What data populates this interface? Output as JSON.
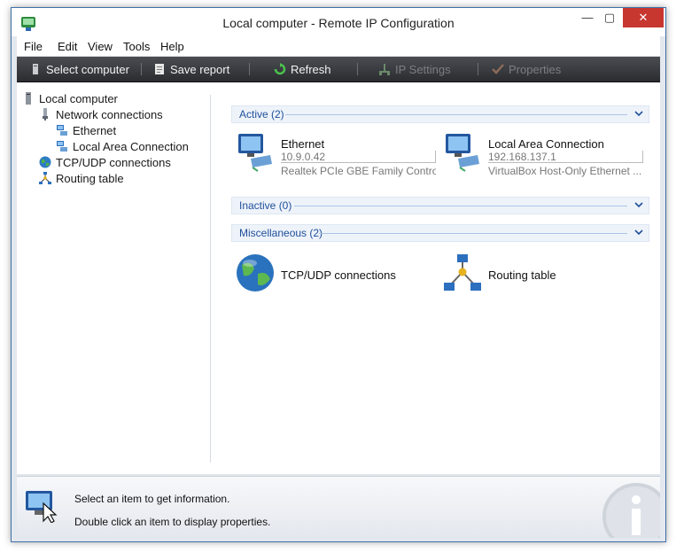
{
  "window": {
    "title": "Local computer - Remote IP Configuration"
  },
  "window_buttons": {
    "minimize": "—",
    "maximize": "▢",
    "close": "✕"
  },
  "menu": [
    "File",
    "Edit",
    "View",
    "Tools",
    "Help"
  ],
  "toolbar": {
    "select_computer": "Select computer",
    "save_report": "Save report",
    "refresh": "Refresh",
    "ip_settings": "IP Settings",
    "properties": "Properties"
  },
  "tree": {
    "root": "Local computer",
    "network_connections": "Network connections",
    "ethernet": "Ethernet",
    "local_area_connection": "Local Area Connection",
    "tcp_udp": "TCP/UDP connections",
    "routing_table": "Routing table"
  },
  "groups": {
    "active": "Active (2)",
    "inactive": "Inactive (0)",
    "miscellaneous": "Miscellaneous (2)"
  },
  "active_items": [
    {
      "name": "Ethernet",
      "ip": "10.9.0.42",
      "description": "Realtek PCIe GBE Family Contro..."
    },
    {
      "name": "Local Area Connection",
      "ip": "192.168.137.1",
      "description": "VirtualBox Host-Only Ethernet ..."
    }
  ],
  "misc_items": [
    {
      "name": "TCP/UDP connections"
    },
    {
      "name": "Routing table"
    }
  ],
  "status": {
    "line1": "Select an item to get information.",
    "line2": "Double click an item to display properties."
  },
  "colors": {
    "toolbar_bg": "#2e3034",
    "group_header_text": "#1f4f9a",
    "close_button": "#c7362f",
    "window_border": "#3f6fa6"
  }
}
